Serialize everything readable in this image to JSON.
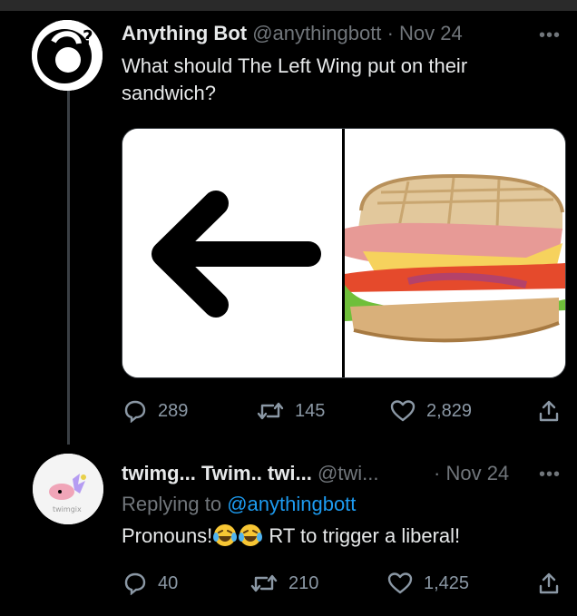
{
  "tweet1": {
    "display_name": "Anything Bot",
    "handle": "@anythingbott",
    "separator": "·",
    "date": "Nov 24",
    "more": "•••",
    "text_line1": "What should The Left Wing put on their",
    "text_line2": "sandwich?",
    "actions": {
      "replies": "289",
      "retweets": "145",
      "likes": "2,829"
    }
  },
  "tweet2": {
    "display_name": "twimg... Twim.. twi...",
    "handle": "@twi...",
    "separator": "·",
    "date": "Nov 24",
    "more": "•••",
    "replying_prefix": "Replying to",
    "replying_handle": "@anythingbott",
    "text_before": "Pronouns!",
    "text_after": " RT to trigger a liberal!",
    "avatar_text": "twimgix",
    "actions": {
      "replies": "40",
      "retweets": "210",
      "likes": "1,425"
    }
  },
  "colors": {
    "background": "#000000",
    "text": "#e7e9ea",
    "muted": "#71767b",
    "link": "#1d9bf0"
  },
  "icons": [
    "reply-icon",
    "retweet-icon",
    "like-icon",
    "share-icon",
    "more-icon",
    "left-arrow-icon",
    "sandwich-image",
    "tears-of-joy-emoji"
  ]
}
